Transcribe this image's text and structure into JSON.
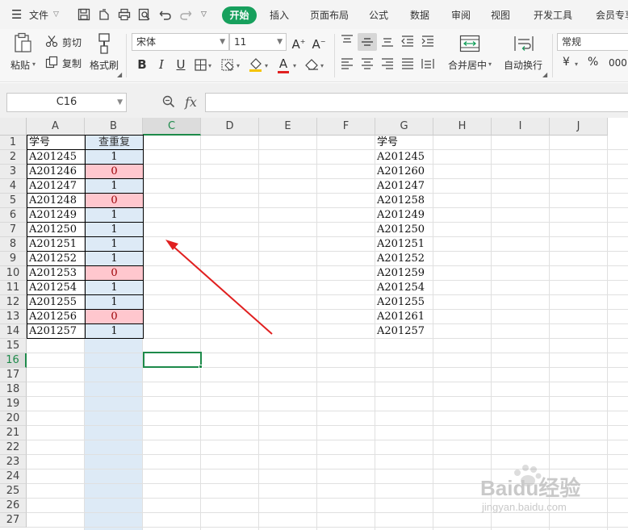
{
  "menubar": {
    "file_menu": "文件",
    "tabs": [
      "开始",
      "插入",
      "页面布局",
      "公式",
      "数据",
      "审阅",
      "视图",
      "开发工具",
      "会员专享"
    ],
    "active_tab_index": 0,
    "accent_color": "#17a05d"
  },
  "ribbon": {
    "paste": "粘贴",
    "cut": "剪切",
    "copy": "复制",
    "format_painter": "格式刷",
    "font_name": "宋体",
    "font_size": "11",
    "merge_center": "合并居中",
    "wrap_text": "自动换行",
    "number_format": "常规",
    "currency_symbol": "¥",
    "percent_symbol": "%",
    "thousands_symbol": "000"
  },
  "formula_bar": {
    "name_box": "C16",
    "fx_label": "fx",
    "formula": ""
  },
  "sheet": {
    "columns": [
      "A",
      "B",
      "C",
      "D",
      "E",
      "F",
      "G",
      "H",
      "I",
      "J"
    ],
    "rows": [
      "1",
      "2",
      "3",
      "4",
      "5",
      "6",
      "7",
      "8",
      "9",
      "10",
      "11",
      "12",
      "13",
      "14",
      "15",
      "16",
      "17",
      "18",
      "19",
      "20",
      "21",
      "22",
      "23",
      "24",
      "25",
      "26",
      "27"
    ],
    "selected_column": "C",
    "selected_row": "16",
    "colA_header": "学号",
    "colB_header": "查重复",
    "colG_header": "学号",
    "colA_values": [
      "A201245",
      "A201246",
      "A201247",
      "A201248",
      "A201249",
      "A201250",
      "A201251",
      "A201252",
      "A201253",
      "A201254",
      "A201255",
      "A201256",
      "A201257"
    ],
    "colB_values": [
      "1",
      "0",
      "1",
      "0",
      "1",
      "1",
      "1",
      "1",
      "0",
      "1",
      "1",
      "0",
      "1"
    ],
    "colG_values": [
      "A201245",
      "A201260",
      "A201247",
      "A201258",
      "A201249",
      "A201250",
      "A201251",
      "A201252",
      "A201259",
      "A201254",
      "A201255",
      "A201261",
      "A201257"
    ],
    "highlight_zero_color": "#ffc7ce",
    "highlight_one_color": "#ddeaf6"
  },
  "watermark": {
    "logo_text": "Baidu经验",
    "url": "jingyan.baidu.com"
  }
}
